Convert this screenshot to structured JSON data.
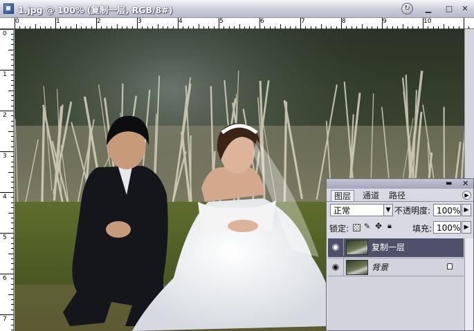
{
  "window": {
    "title": "1.jpg @ 100% (复制一层, RGB/8#)",
    "buttons": {
      "minimize": "▁",
      "maximize": "□",
      "close": "✕"
    }
  },
  "rulers": {
    "horizontal": [
      "0",
      "1",
      "2",
      "3",
      "4",
      "5",
      "6",
      "7",
      "8",
      "9",
      "10"
    ],
    "vertical": [
      "0",
      "1",
      "2",
      "3",
      "4",
      "5",
      "6",
      "7"
    ]
  },
  "layers_panel": {
    "tabs": [
      "图层",
      "通道",
      "路径"
    ],
    "blend_mode": "正常",
    "opacity_label": "不透明度:",
    "opacity_value": "100%",
    "lock_label": "锁定:",
    "fill_label": "填充:",
    "fill_value": "100%",
    "layers": [
      {
        "name": "复制一层",
        "selected": true,
        "locked": false
      },
      {
        "name": "背景",
        "selected": false,
        "locked": true
      }
    ]
  },
  "colors": {
    "selected_layer": "#4f5069",
    "panel_bg": "#d8d9e3",
    "title_text": "#ffffff"
  }
}
